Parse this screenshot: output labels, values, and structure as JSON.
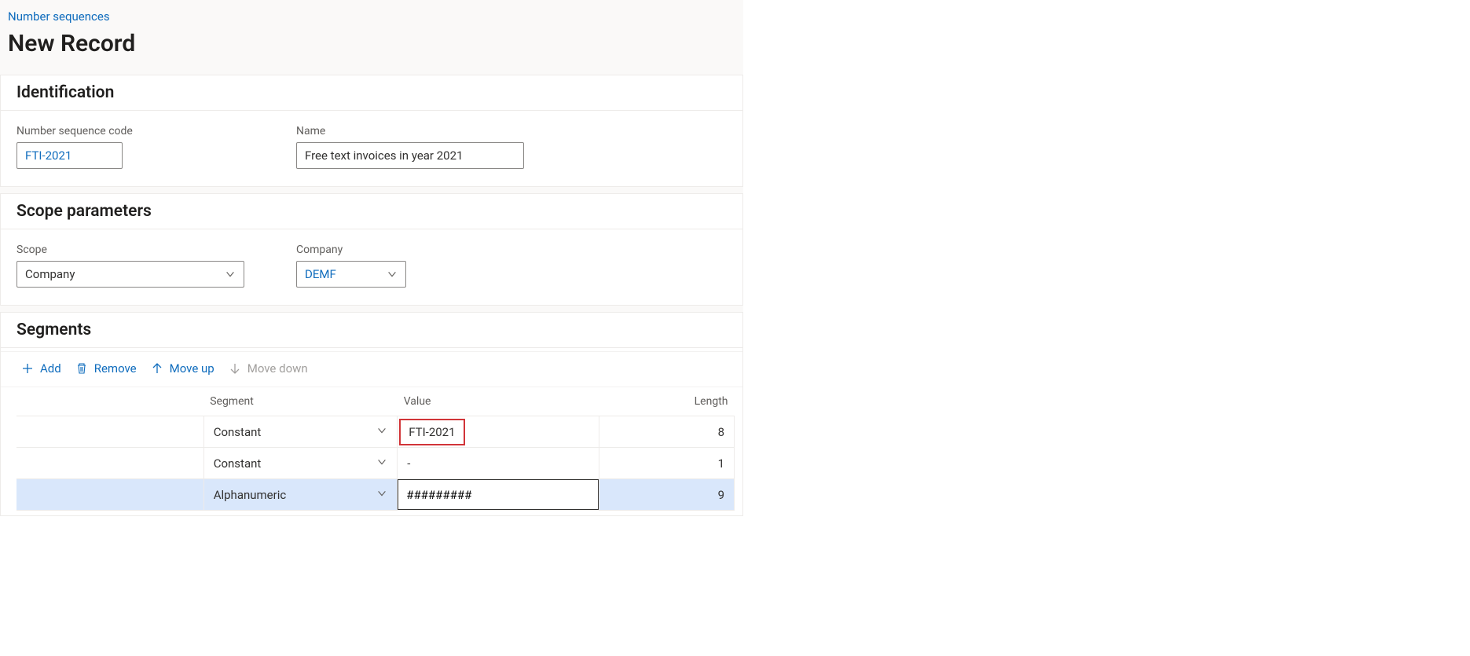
{
  "breadcrumb": "Number sequences",
  "page_title": "New Record",
  "identification": {
    "header": "Identification",
    "code_label": "Number sequence code",
    "code_value": "FTI-2021",
    "name_label": "Name",
    "name_value": "Free text invoices in year 2021"
  },
  "scope": {
    "header": "Scope parameters",
    "scope_label": "Scope",
    "scope_value": "Company",
    "company_label": "Company",
    "company_value": "DEMF"
  },
  "segments": {
    "header": "Segments",
    "toolbar": {
      "add": "Add",
      "remove": "Remove",
      "move_up": "Move up",
      "move_down": "Move down"
    },
    "columns": {
      "segment": "Segment",
      "value": "Value",
      "length": "Length"
    },
    "rows": [
      {
        "segment": "Constant",
        "value": "FTI-2021",
        "length": "8",
        "highlight_value": true,
        "selected": false,
        "editing": false
      },
      {
        "segment": "Constant",
        "value": "-",
        "length": "1",
        "highlight_value": false,
        "selected": false,
        "editing": false
      },
      {
        "segment": "Alphanumeric",
        "value": "#########",
        "length": "9",
        "highlight_value": false,
        "selected": true,
        "editing": true
      }
    ]
  }
}
